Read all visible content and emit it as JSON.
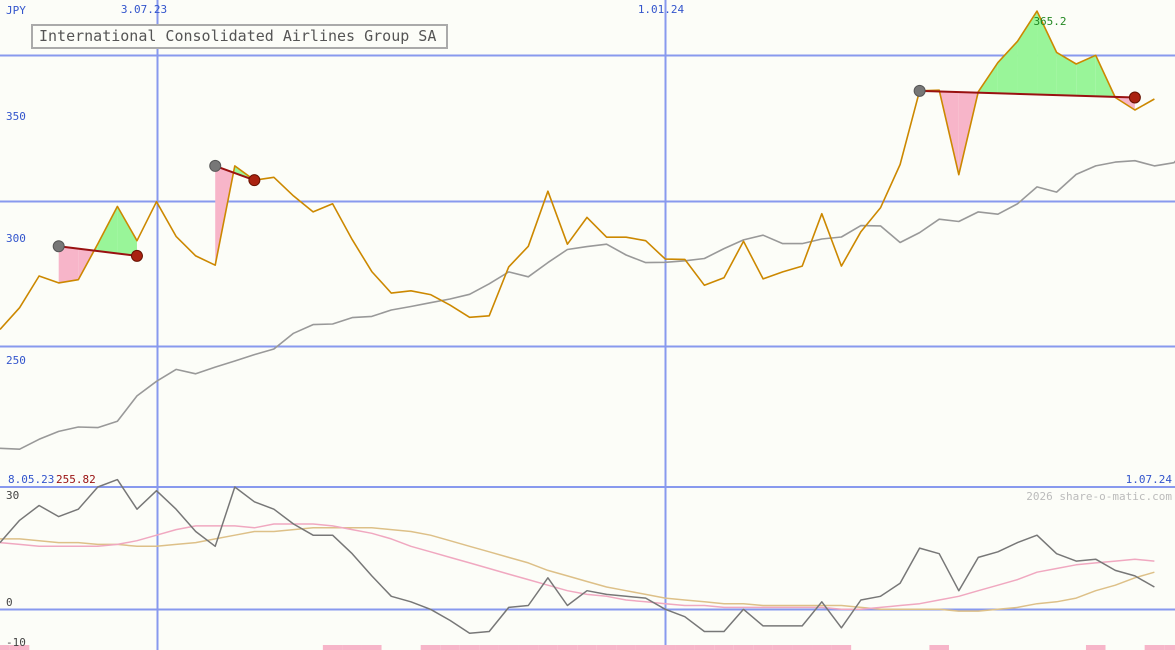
{
  "chart_data": [
    {
      "type": "line",
      "title": "International Consolidated Airlines Group SA",
      "currency": "JPY",
      "x_start_label": "8.05.23",
      "x_end_label": "1.07.24",
      "x_tick_labels": [
        "3.07.23",
        "1.01.24"
      ],
      "first_value_label": "255.82",
      "max_value_label": "365.2",
      "ylabel": "JPY",
      "y_tick_labels": [
        "250",
        "300",
        "350"
      ],
      "ylim": [
        201.7,
        369
      ],
      "grid": true,
      "x": [
        "2023-05-08",
        "2023-05-15",
        "2023-05-22",
        "2023-05-29",
        "2023-06-05",
        "2023-06-12",
        "2023-06-19",
        "2023-06-26",
        "2023-07-03",
        "2023-07-10",
        "2023-07-17",
        "2023-07-24",
        "2023-07-31",
        "2023-08-07",
        "2023-08-14",
        "2023-08-21",
        "2023-08-28",
        "2023-09-04",
        "2023-09-11",
        "2023-09-18",
        "2023-09-25",
        "2023-10-02",
        "2023-10-09",
        "2023-10-16",
        "2023-10-23",
        "2023-10-30",
        "2023-11-06",
        "2023-11-13",
        "2023-11-20",
        "2023-11-27",
        "2023-12-04",
        "2023-12-11",
        "2023-12-18",
        "2023-12-25",
        "2024-01-01",
        "2024-01-08",
        "2024-01-15",
        "2024-01-22",
        "2024-01-29",
        "2024-02-05",
        "2024-02-12",
        "2024-02-19",
        "2024-02-26",
        "2024-03-04",
        "2024-03-11",
        "2024-03-18",
        "2024-03-25",
        "2024-04-01",
        "2024-04-08",
        "2024-04-15",
        "2024-04-22",
        "2024-04-29",
        "2024-05-06",
        "2024-05-13",
        "2024-05-20",
        "2024-05-27",
        "2024-06-03",
        "2024-06-10",
        "2024-06-17",
        "2024-06-24",
        "2024-07-01"
      ],
      "series": [
        {
          "color": "#cc8800",
          "values": [
            255.8,
            263.3,
            274.2,
            271.8,
            272.9,
            285.2,
            298.1,
            286.3,
            299.7,
            287.8,
            281.1,
            277.9,
            312,
            307.1,
            308.1,
            301.7,
            296.2,
            299,
            286.7,
            275.7,
            268.3,
            269.1,
            267.8,
            264.2,
            260,
            260.5,
            277.3,
            284.4,
            303.3,
            285.1,
            294.3,
            287.5,
            287.5,
            286.3,
            280,
            279.9,
            271,
            273.6,
            286.1,
            273.2,
            275.6,
            277.6,
            295.6,
            277.6,
            289.4,
            297.6,
            312.5,
            337.8,
            338,
            309,
            337.5,
            347.5,
            354.8,
            365.2,
            351,
            347,
            350,
            335.5,
            331.2,
            335
          ]
        },
        {
          "color": "#999999",
          "values": [
            215,
            214.7,
            218.1,
            220.8,
            222.3,
            222.1,
            224.3,
            233,
            238,
            242.1,
            240.6,
            242.9,
            245,
            247.2,
            249.1,
            254.5,
            257.5,
            257.7,
            259.9,
            260.3,
            262.5,
            263.7,
            265,
            266.3,
            267.9,
            271.5,
            275.6,
            273.9,
            278.8,
            283.3,
            284.3,
            285.1,
            281.4,
            278.8,
            278.9,
            279.4,
            280.2,
            283.6,
            286.6,
            288.2,
            285.3,
            285.3,
            286.9,
            287.6,
            291.5,
            291.4,
            285.7,
            289.1,
            293.7,
            292.9,
            296.2,
            295.4,
            299,
            304.8,
            303,
            309.1,
            312,
            313.3,
            313.8,
            312,
            313.1,
            320.7
          ]
        }
      ],
      "highlight_markers": [
        {
          "start": "2023-05-29",
          "end": "2023-06-26",
          "start_value": 284.4,
          "end_value": 281.1
        },
        {
          "start": "2023-07-24",
          "end": "2023-08-07",
          "start_value": 312,
          "end_value": 307.1
        },
        {
          "start": "2024-04-01",
          "end": "2024-06-17",
          "start_value": 337.8,
          "end_value": 335.5
        }
      ]
    },
    {
      "type": "line",
      "watermark": "2026 share-o-matic.com",
      "y_tick_labels": [
        "30",
        "0",
        "-10"
      ],
      "ylim": [
        -11,
        33
      ],
      "grid": true,
      "series": [
        {
          "color": "#777777",
          "values": [
            18,
            24,
            28,
            25,
            27,
            33,
            35,
            27,
            32,
            27,
            21,
            17,
            33,
            29,
            27,
            23,
            20,
            20,
            15,
            9,
            3.5,
            2,
            0,
            -3,
            -6.5,
            -6,
            0.5,
            1,
            8.5,
            1,
            5,
            4,
            3.5,
            3,
            0,
            -2,
            -6,
            -6,
            0,
            -4.5,
            -4.5,
            -4.5,
            2,
            -5,
            2.5,
            3.5,
            7,
            16.5,
            15,
            5,
            14,
            15.5,
            18,
            20,
            15,
            13,
            13.5,
            10.5,
            9,
            6
          ]
        },
        {
          "color": "#f0a8c0",
          "values": [
            18,
            17.5,
            17,
            17,
            17,
            17,
            17.5,
            18.5,
            20,
            21.5,
            22.5,
            22.5,
            22.5,
            22,
            23,
            23,
            23,
            22.5,
            21.5,
            20.5,
            19,
            17,
            15.5,
            14,
            12.5,
            11,
            9.5,
            8,
            6.5,
            5,
            4,
            3.5,
            2.5,
            2,
            1.5,
            1,
            1,
            0.5,
            0.5,
            0.5,
            0.5,
            0.5,
            0.5,
            0,
            0,
            0.5,
            1,
            1.5,
            2.5,
            3.5,
            5,
            6.5,
            8,
            10,
            11,
            12,
            12.5,
            13,
            13.5,
            13
          ]
        },
        {
          "color": "#ddc088",
          "values": [
            19,
            19,
            18.5,
            18,
            18,
            17.5,
            17.5,
            17,
            17,
            17.5,
            18,
            19,
            20,
            21,
            21,
            21.5,
            22,
            22,
            22,
            22,
            21.5,
            21,
            20,
            18.5,
            17,
            15.5,
            14,
            12.5,
            10.5,
            9,
            7.5,
            6,
            5,
            4,
            3,
            2.5,
            2,
            1.5,
            1.5,
            1,
            1,
            1,
            1,
            1,
            0.5,
            0,
            0,
            0,
            0,
            -0.5,
            -0.5,
            0,
            0.5,
            1.5,
            2,
            3,
            5,
            6.5,
            8.5,
            10
          ]
        }
      ],
      "bars_color": "#f7b5c9",
      "bars": [
        1,
        1,
        0,
        0,
        0,
        0,
        0,
        0,
        0,
        0,
        0,
        0,
        0,
        0,
        0,
        0,
        0,
        1,
        1,
        1,
        0,
        0,
        1,
        1,
        1,
        1,
        1,
        1,
        1,
        1,
        1,
        1,
        1,
        1,
        1,
        1,
        1,
        1,
        1,
        1,
        1,
        1,
        1,
        1,
        0,
        0,
        0,
        0,
        1,
        0,
        0,
        0,
        0,
        0,
        0,
        0,
        1,
        0,
        0,
        1,
        1
      ]
    }
  ]
}
